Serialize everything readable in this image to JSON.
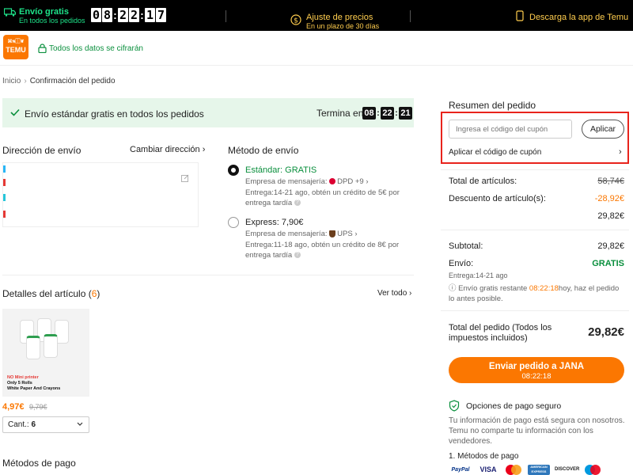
{
  "topbar": {
    "free_line1": "Envío gratis",
    "free_line2": "En todos los pedidos",
    "timer": [
      "0",
      "8",
      ":",
      "2",
      "2",
      ":",
      "1",
      "7"
    ],
    "price_adj_line1": "Ajuste de precios",
    "price_adj_line2": "En un plazo de 30 días",
    "app_download": "Descarga la app de Temu"
  },
  "header": {
    "logo_top": "⌘พ⿰❦",
    "logo_bottom": "TEMU",
    "secure_text": "Todos los datos se cifrarán"
  },
  "breadcrumb": {
    "home": "Inicio",
    "separator": "›",
    "current": "Confirmación del pedido"
  },
  "ship_banner": {
    "text": "Envío estándar gratis en todos los pedidos",
    "ends_label": "Termina en",
    "h": "08",
    "m": "22",
    "s": "21"
  },
  "address": {
    "title": "Dirección de envío",
    "change_label": "Cambiar dirección ›"
  },
  "shipping_method": {
    "title": "Método de envío",
    "options": [
      {
        "name": "Estándar: GRATIS",
        "carrier_label": "Empresa de mensajería:",
        "carrier": "DPD",
        "carrier_more": "+9 ›",
        "delivery": "Entrega:14-21 ago, obtén un crédito de 5€ por",
        "delivery2": "entrega tardía",
        "selected": true
      },
      {
        "name": "Express: 7,90€",
        "carrier_label": "Empresa de mensajería:",
        "carrier": "UPS",
        "carrier_more": "›",
        "delivery": "Entrega:11-18 ago, obtén un crédito de 8€ por",
        "delivery2": "entrega tardía",
        "selected": false
      }
    ]
  },
  "details": {
    "title": "Detalles del artículo (",
    "count": "6",
    "title_end": ")",
    "see_all": "Ver todo ›",
    "product": {
      "img_line1": "NO Mini printer",
      "img_line2": "Only 5 Rolls",
      "img_line3": "White Paper And Crayons",
      "price": "4,97€",
      "old_price": "9,79€",
      "qty_label": "Cant.:",
      "qty_value": "6"
    }
  },
  "payment_methods_title": "Métodos de pago",
  "summary": {
    "title": "Resumen del pedido",
    "coupon_placeholder": "Ingresa el código del cupón",
    "apply_button": "Aplicar",
    "apply_coupon_link": "Aplicar el código de cupón",
    "total_items_label": "Total de artículos:",
    "total_items_value": "58,74€",
    "discount_label": "Descuento de artículo(s):",
    "discount_value": "-28,92€",
    "after_discount": "29,82€",
    "subtotal_label": "Subtotal:",
    "subtotal_value": "29,82€",
    "shipping_label": "Envío:",
    "shipping_value": "GRATIS",
    "delivery_dates": "Entrega:14-21 ago",
    "note_pre": "ⓘ Envío gratis restante ",
    "note_time": "08:22:18",
    "note_post": "hoy, haz el pedido lo antes posible.",
    "order_total_label": "Total del pedido (Todos los impuestos incluidos)",
    "order_total_value": "29,82€",
    "submit_label": "Enviar pedido a JANA",
    "submit_timer": "08:22:18",
    "secure_payment": "Opciones de pago seguro",
    "secure_desc": "Tu información de pago está segura con nosotros. Temu no comparte tu información con los vendedores.",
    "methods_title": "1. Métodos de pago",
    "methods": [
      "PayPal",
      "VISA",
      "",
      "AMERICAN EXPRESS",
      "DISCOVER",
      ""
    ]
  },
  "colors": {
    "accent": "#fb7701",
    "green": "#0a8f3d",
    "highlight": "#e8231c"
  }
}
